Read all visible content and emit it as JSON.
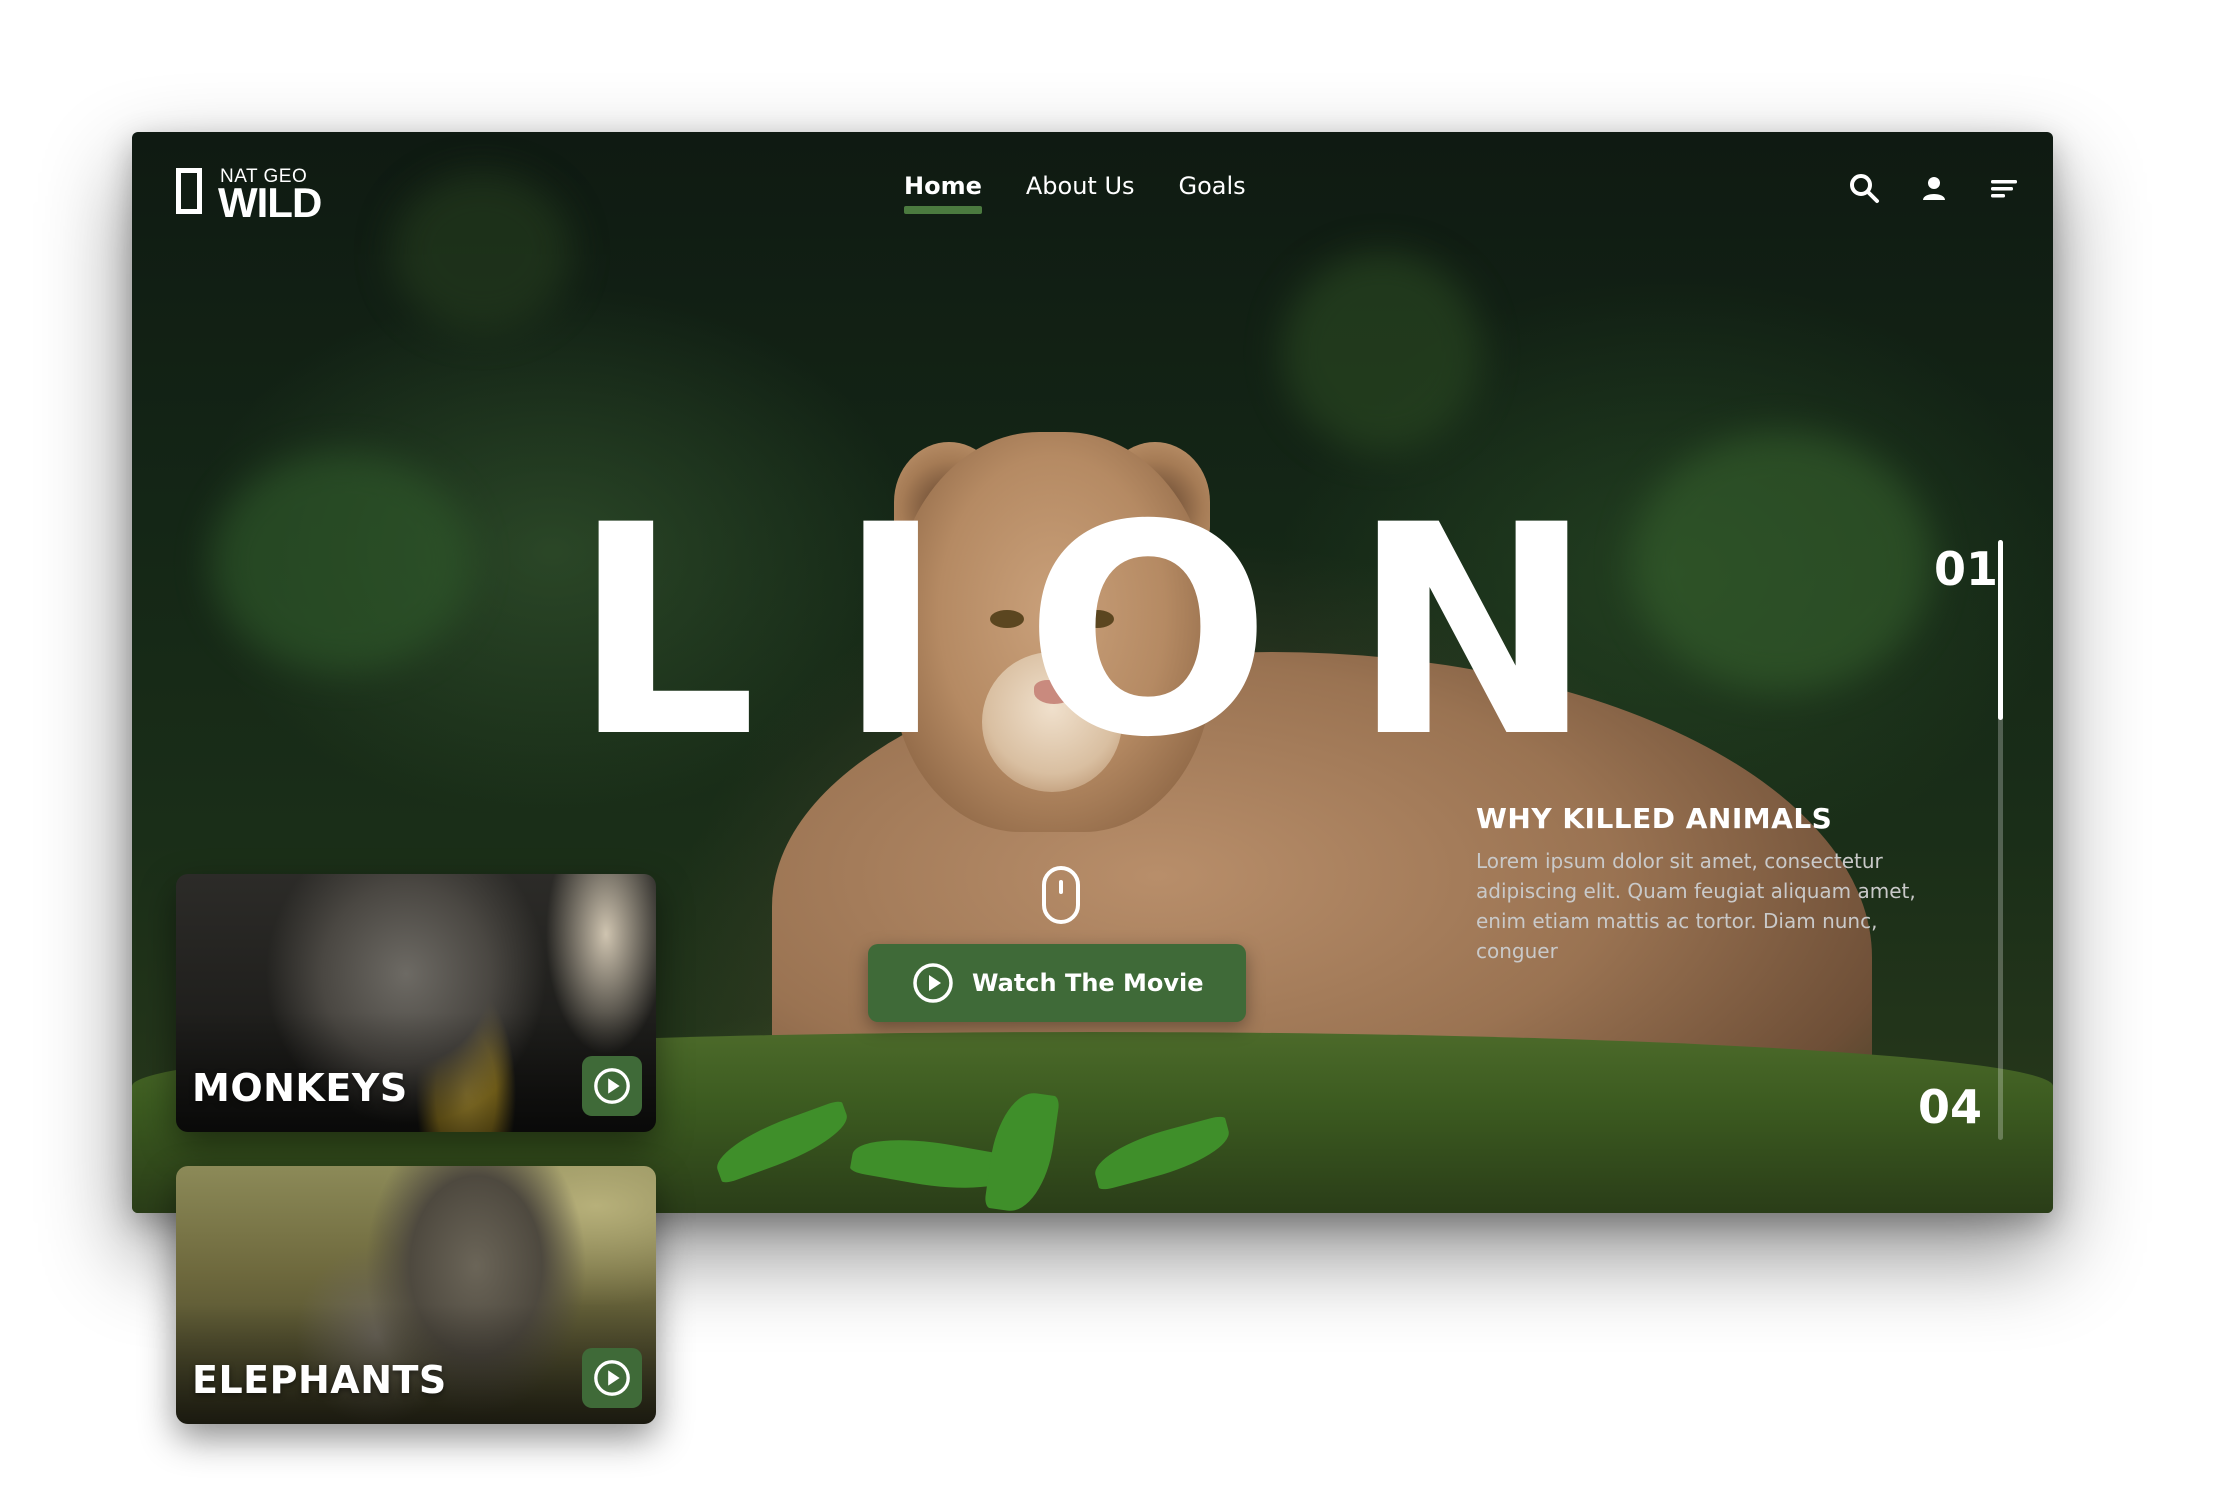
{
  "brand": {
    "line1": "NAT GEO",
    "line2": "WILD"
  },
  "nav": {
    "items": [
      {
        "label": "Home",
        "active": true
      },
      {
        "label": "About Us",
        "active": false
      },
      {
        "label": "Goals",
        "active": false
      }
    ]
  },
  "header_icons": [
    "search-icon",
    "user-icon",
    "menu-icon"
  ],
  "hero": {
    "title": "LION",
    "cta_label": "Watch The Movie",
    "scroll_hint_icon": "mouse-icon"
  },
  "slides": {
    "current": "01",
    "total": "04",
    "progress": 0.3
  },
  "info": {
    "title": "WHY KILLED ANIMALS",
    "text": "Lorem ipsum dolor sit amet, consectetur adipiscing elit. Quam feugiat aliquam amet, enim etiam mattis ac tortor. Diam nunc, conguer"
  },
  "cards": [
    {
      "title": "MONKEYS",
      "icon": "play-icon"
    },
    {
      "title": "ELEPHANTS",
      "icon": "play-icon"
    }
  ],
  "colors": {
    "accent": "#3f6a38",
    "text": "#ffffff",
    "muted": "#c9c9c9"
  }
}
